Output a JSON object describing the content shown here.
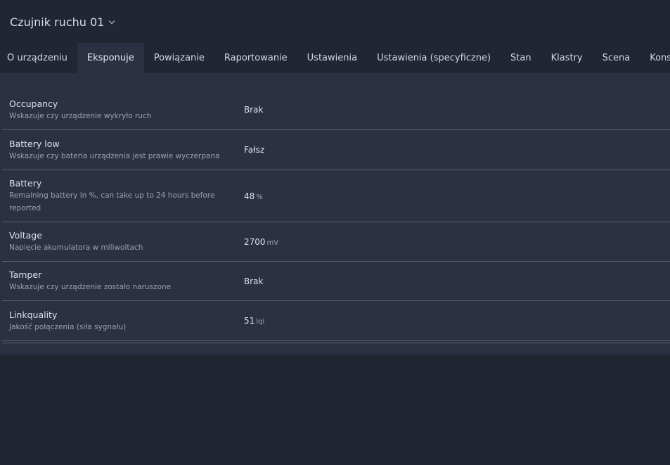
{
  "device": {
    "title": "Czujnik ruchu 01"
  },
  "tabs": [
    {
      "label": "O urządzeniu"
    },
    {
      "label": "Eksponuje"
    },
    {
      "label": "Powiązanie"
    },
    {
      "label": "Raportowanie"
    },
    {
      "label": "Ustawienia"
    },
    {
      "label": "Ustawienia (specyficzne)"
    },
    {
      "label": "Stan"
    },
    {
      "label": "Klastry"
    },
    {
      "label": "Scena"
    },
    {
      "label": "Konsola"
    }
  ],
  "active_tab": "Eksponuje",
  "exposes": [
    {
      "name": "Occupancy",
      "description": "Wskazuje czy urządzenie wykryło ruch",
      "value": "Brak",
      "unit": ""
    },
    {
      "name": "Battery low",
      "description": "Wskazuje czy bateria urządzenia jest prawie wyczerpana",
      "value": "Fałsz",
      "unit": ""
    },
    {
      "name": "Battery",
      "description": "Remaining battery in %, can take up to 24 hours before reported",
      "value": "48",
      "unit": "%"
    },
    {
      "name": "Voltage",
      "description": "Napięcie akumulatora w miliwoltach",
      "value": "2700",
      "unit": "mV"
    },
    {
      "name": "Tamper",
      "description": "Wskazuje czy urządzenie zostało naruszone",
      "value": "Brak",
      "unit": ""
    },
    {
      "name": "Linkquality",
      "description": "Jakość połączenia (siła sygnału)",
      "value": "51",
      "unit": "lqi"
    }
  ]
}
